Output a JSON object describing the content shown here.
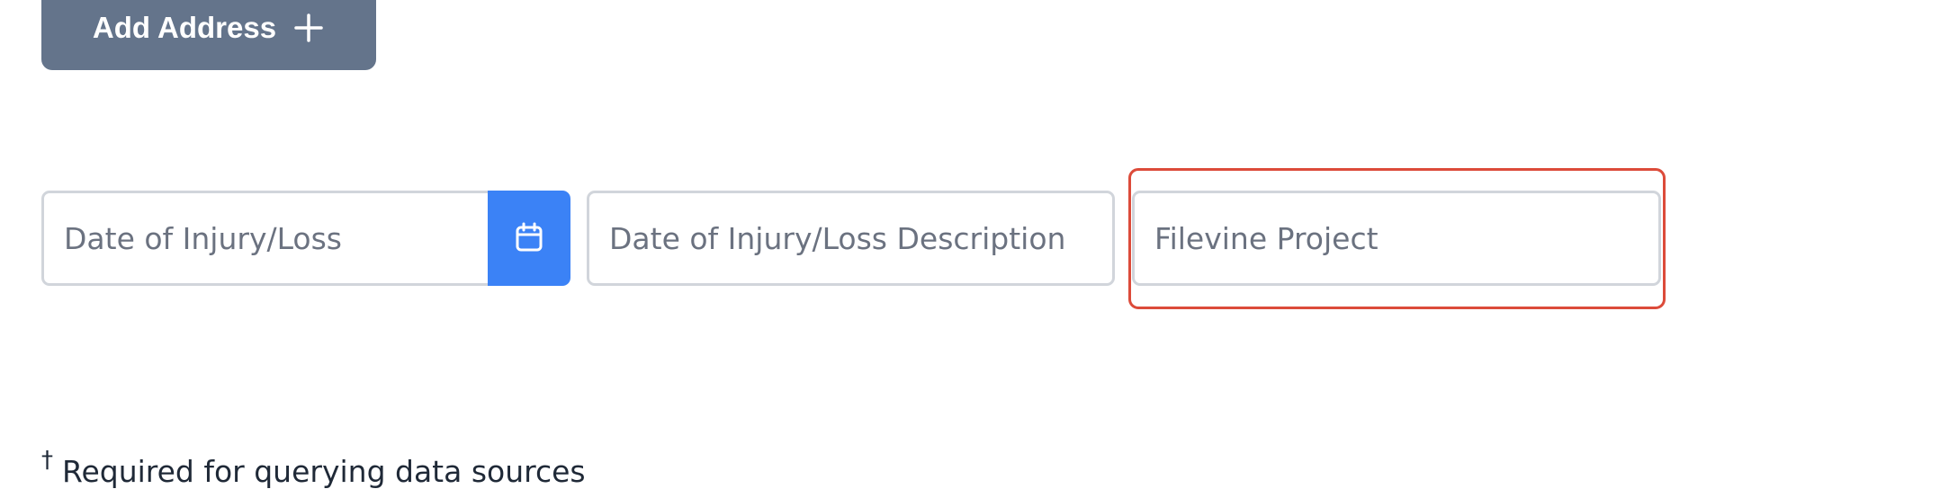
{
  "add_address": {
    "label": "Add Address",
    "icon": "plus-icon"
  },
  "form": {
    "date_of_injury": {
      "placeholder": "Date of Injury/Loss",
      "value": ""
    },
    "calendar_button": {
      "icon": "calendar-icon",
      "color": "#3b82f6"
    },
    "date_description": {
      "placeholder": "Date of Injury/Loss Description",
      "value": ""
    },
    "filevine_project": {
      "placeholder": "Filevine Project",
      "value": "",
      "highlight_color": "#dc4b3a"
    }
  },
  "footnote": {
    "marker": "†",
    "text": "Required for querying data sources"
  },
  "colors": {
    "button_gray": "#64748b",
    "accent_blue": "#3b82f6",
    "border": "#d1d5db"
  }
}
